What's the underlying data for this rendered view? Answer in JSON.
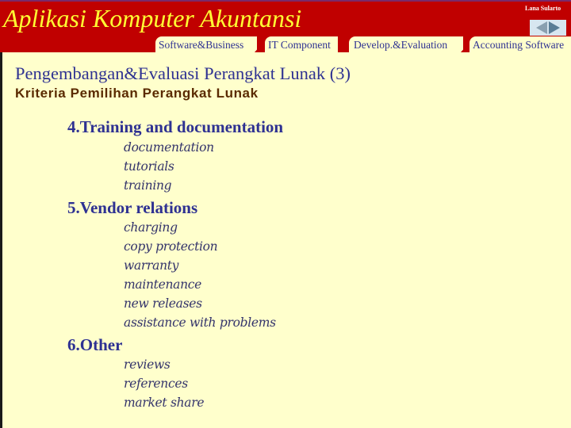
{
  "header": {
    "app_title": "Aplikasi Komputer Akuntansi",
    "author": "Lana Sularto",
    "nav": {
      "prev_icon": "triangle-left",
      "next_icon": "triangle-right"
    }
  },
  "tabs": [
    {
      "label": "Software&Business"
    },
    {
      "label": "IT Component"
    },
    {
      "label": "Develop.&Evaluation"
    },
    {
      "label": "Accounting Software"
    }
  ],
  "main": {
    "title": "Pengembangan&Evaluasi Perangkat Lunak (3)",
    "subtitle": "Kriteria Pemilihan Perangkat Lunak",
    "criteria": [
      {
        "heading": "4.Training and documentation",
        "items": [
          "documentation",
          "tutorials",
          "training"
        ]
      },
      {
        "heading": "5.Vendor relations",
        "items": [
          "charging",
          "copy protection",
          "warranty",
          "maintenance",
          "new releases",
          "assistance with problems"
        ]
      },
      {
        "heading": "6.Other",
        "items": [
          "reviews",
          "references",
          "market share"
        ]
      }
    ]
  },
  "colors": {
    "header_bg": "#c00000",
    "title_yellow": "#ffff33",
    "page_bg": "#ffffcc",
    "heading_blue": "#2e3192",
    "subtitle_brown": "#5a2a00"
  }
}
